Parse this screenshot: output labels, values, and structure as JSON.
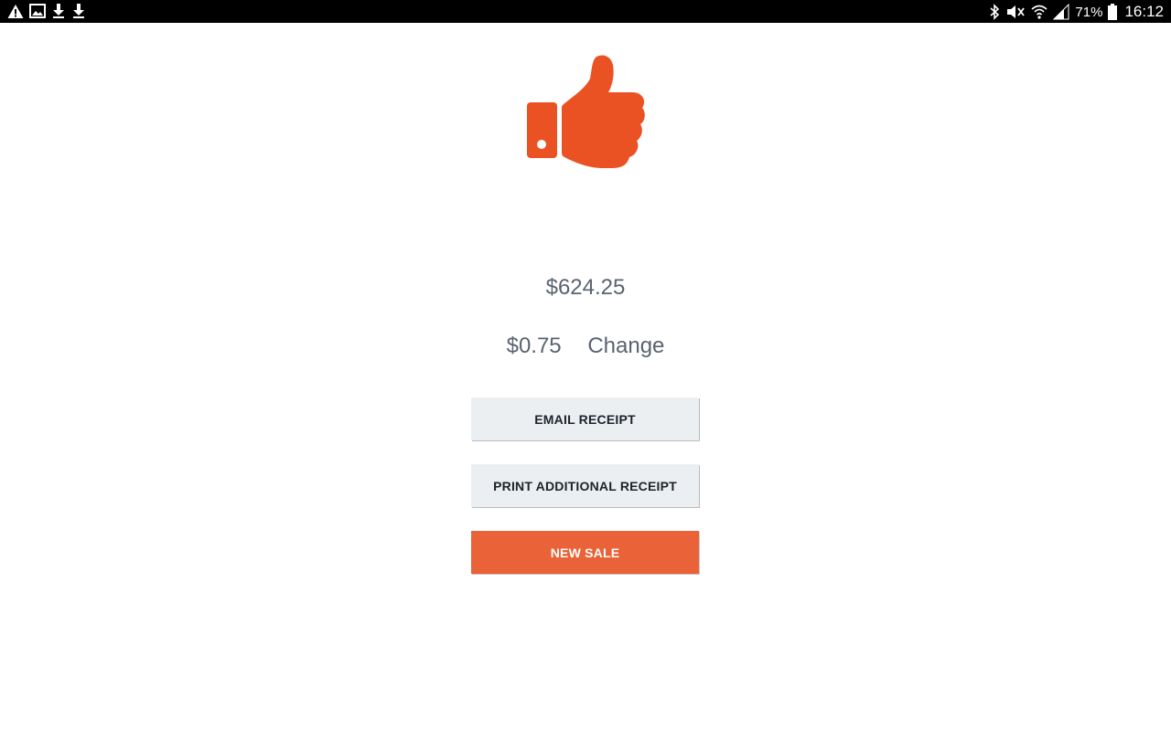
{
  "status_bar": {
    "left_icons": [
      "warning-icon",
      "image-icon",
      "download-icon",
      "download-icon"
    ],
    "right_icons": [
      "bluetooth-icon",
      "mute-icon",
      "wifi-icon",
      "signal-icon",
      "battery-icon"
    ],
    "battery_percent": "71%",
    "time": "16:12"
  },
  "success_icon": "thumbs-up-icon",
  "payment": {
    "total": "$624.25",
    "change_amount": "$0.75",
    "change_label": "Change"
  },
  "actions": {
    "email_receipt": "EMAIL RECEIPT",
    "print_receipt": "PRINT ADDITIONAL RECEIPT",
    "new_sale": "NEW SALE"
  },
  "colors": {
    "accent": "#ea5224",
    "button_primary": "#ea6237",
    "button_secondary": "#eceff2",
    "text": "#5a6370"
  }
}
